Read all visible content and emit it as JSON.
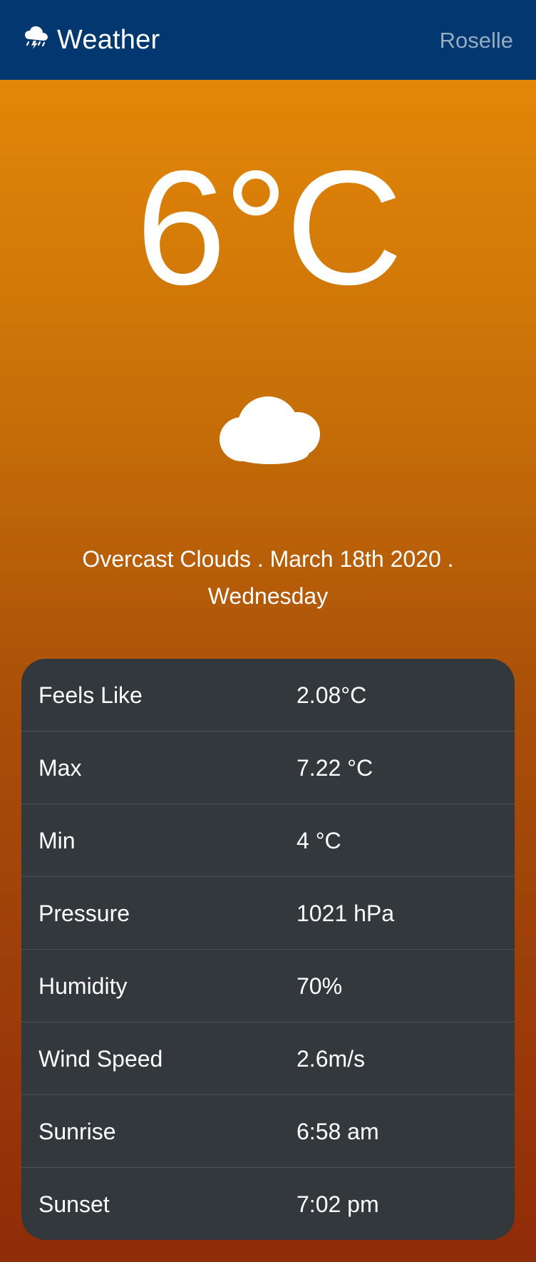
{
  "header": {
    "brand_icon": "storm-cloud-icon",
    "brand": "Weather",
    "city": "Roselle"
  },
  "weather": {
    "temperature": "6°C",
    "icon": "cloud-icon",
    "description_line1": "Overcast Clouds . March 18th 2020 .",
    "description_line2": "Wednesday"
  },
  "details": [
    {
      "label": "Feels Like",
      "value": "2.08°C"
    },
    {
      "label": "Max",
      "value": "7.22 °C"
    },
    {
      "label": "Min",
      "value": "4 °C"
    },
    {
      "label": "Pressure",
      "value": "1021 hPa"
    },
    {
      "label": "Humidity",
      "value": "70%"
    },
    {
      "label": "Wind Speed",
      "value": "2.6m/s"
    },
    {
      "label": "Sunrise",
      "value": "6:58 am"
    },
    {
      "label": "Sunset",
      "value": "7:02 pm"
    }
  ],
  "colors": {
    "navbar": "#02376f",
    "gradient_top": "#e38708",
    "gradient_bottom": "#8f2c09",
    "card": "#33383d",
    "text": "#ffffff"
  }
}
